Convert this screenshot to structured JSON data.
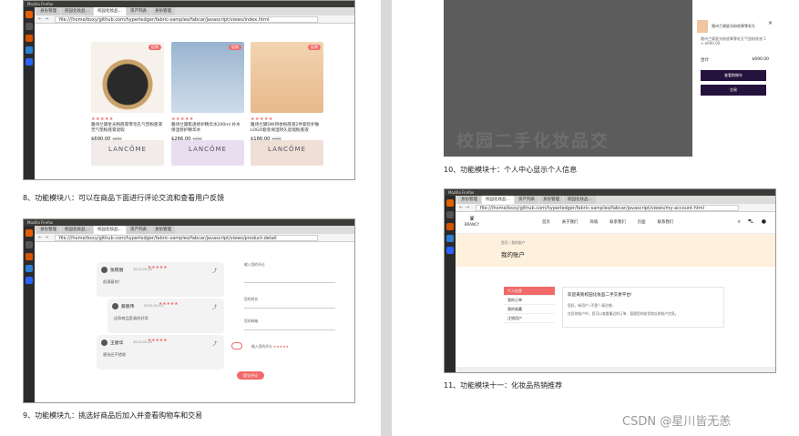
{
  "captions": {
    "c8": "8、功能模块八：可以在商品下面进行评论交流和查看用户反馈",
    "c9": "9、功能模块九：挑选好商品后加入并查看购物车和交易",
    "c10": "10、功能模块十：个人中心显示个人信息",
    "c11": "11、功能模块十一：化妆品热销推荐"
  },
  "watermark": "CSDN @星川皆无恙",
  "browser": {
    "top_title": "Mozilla Firefox",
    "tabs": [
      "身份管理",
      "校园化妆品…",
      "资产列表",
      "身份管理",
      "校园化妆品…"
    ]
  },
  "shot_products": {
    "url": "file:///home/bsxy/github.com/hyperledger/fabric-samples/fabcar/javascript/views/index.html",
    "badge": "促销",
    "stars": "★★★★★",
    "items": [
      {
        "desc": "雅诗兰黛星光粉底膏零毛孔气垫粉底液无气垫粉底膏遮瑕",
        "price": "$690.00",
        "old": "$800"
      },
      {
        "desc": "雅诗兰黛肌透修护精华水200ml 补水保湿修护精华水",
        "price": "$266.00",
        "old": "$300"
      },
      {
        "desc": "雅诗兰黛DW持妆粉底液2件套装护肤LOGO套装保湿持久遮瑕粉底液",
        "price": "$166.00",
        "old": "$190"
      }
    ],
    "brands": [
      "LANCÔME",
      "LANCÔME",
      "LANCÔME"
    ]
  },
  "shot_comments": {
    "url": "file:///home/bsxy/github.com/hyperledger/fabric-samples/fabcar/javascript/views/product-detail",
    "comments": [
      {
        "name": "张晓丽",
        "date": "2023-03-14",
        "text": "很满意的!"
      },
      {
        "name": "蔡丽伟",
        "date": "2023-03-14",
        "text": "这款商品是真的好用"
      },
      {
        "name": "王丽华",
        "date": "2023-03-14",
        "text": "感觉还不错呢"
      }
    ],
    "form_labels": [
      "输入您的评论",
      "您的姓名",
      "您的邮箱"
    ],
    "rate_label": "输入您的评分",
    "submit": "提交评论",
    "reply_icon": "⤴"
  },
  "shot_cart": {
    "ghost_text": "校园二手化妆品交",
    "item_title": "雅诗兰黛星光粉底膏零毛孔",
    "item_sub": "雅诗兰黛星光粉底膏零毛孔气垫粉底液 1 × $690.00",
    "total_label": "合计",
    "total_value": "$690.00",
    "btn_view": "查看购物车",
    "btn_checkout": "交易"
  },
  "shot_account": {
    "url": "file:///home/bsxy/github.com/hyperledger/fabric-samples/fabcar/javascript/views/my-account.html",
    "logo": "BRANCY",
    "menu": [
      "首页",
      "关于我们",
      "商城",
      "联系我们",
      "页面",
      "联系我们"
    ],
    "crumb": "首页 / 我的账户",
    "heading": "我的账户",
    "nav": [
      "个人信息",
      "我的订单",
      "我的收藏",
      "注销用户"
    ],
    "welcome": "欢迎来到校园化妆品二手交易平台!",
    "info1": "您好，新用户 (不是？请注销)",
    "info2": "在您的账户中，您可以查看最近的订单、管理您的收货地址和账户信息。"
  },
  "colors": {
    "accent": "#f06a6a",
    "dark_button": "#25123d",
    "peach": "#fdf0dc"
  }
}
